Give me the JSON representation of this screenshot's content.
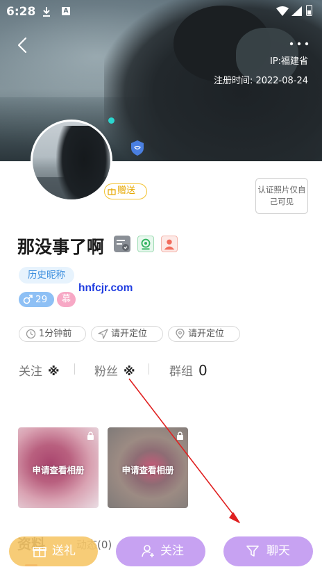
{
  "status_bar": {
    "time": "6:28",
    "icons": [
      "download-icon",
      "a-badge-icon",
      "wifi-icon",
      "signal-icon",
      "battery-icon"
    ],
    "a_badge": "A"
  },
  "header": {
    "ip": "IP:福建省",
    "register_time": "注册时间: 2022-08-24"
  },
  "profile": {
    "gift_tag": "赠送",
    "verify_note": "认证照片仅自己可见",
    "nickname": "那没事了啊",
    "history_nickname": "历史昵称",
    "age": "29",
    "mu_tag": "慕",
    "watermark": "hnfcjr.com"
  },
  "chips": {
    "last_active": "1分钟前",
    "location_1": "请开定位",
    "location_2": "请开定位"
  },
  "stats": {
    "follow_label": "关注",
    "follow_value": "※",
    "fans_label": "粉丝",
    "fans_value": "※",
    "group_label": "群组",
    "group_value": "0"
  },
  "albums": [
    {
      "label": "申请查看相册"
    },
    {
      "label": "申请查看相册"
    }
  ],
  "tabs": {
    "profile": "资料",
    "moments": "动态(0)"
  },
  "actions": {
    "gift": "送礼",
    "follow": "关注",
    "chat": "聊天"
  },
  "colors": {
    "accent_purple": "#c7a2f2",
    "gift_yellow": "#f6c768",
    "tag_blue": "#3e8fde",
    "annotation_red": "#e02020"
  }
}
